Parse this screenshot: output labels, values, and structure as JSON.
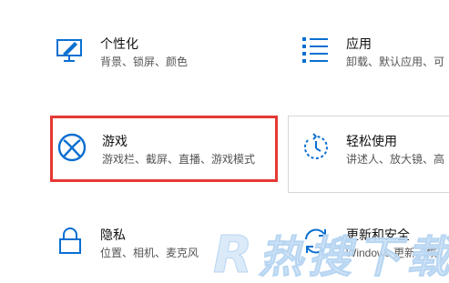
{
  "accent_color": "#0a6fd0",
  "highlight_color": "#e53935",
  "tiles": {
    "personalization": {
      "title": "个性化",
      "desc": "背景、锁屏、颜色",
      "icon": "personalization-icon"
    },
    "apps": {
      "title": "应用",
      "desc": "卸载、默认应用、可",
      "icon": "apps-list-icon"
    },
    "gaming": {
      "title": "游戏",
      "desc": "游戏栏、截屏、直播、游戏模式",
      "icon": "xbox-icon"
    },
    "ease": {
      "title": "轻松使用",
      "desc": "讲述人、放大镜、高",
      "icon": "ease-of-access-icon"
    },
    "privacy": {
      "title": "隐私",
      "desc": "位置、相机、麦克风",
      "icon": "lock-icon"
    },
    "update": {
      "title": "更新和安全",
      "desc": "Windows 更新、恢",
      "icon": "refresh-icon"
    }
  },
  "watermark": {
    "text": "R 热搜下载"
  }
}
